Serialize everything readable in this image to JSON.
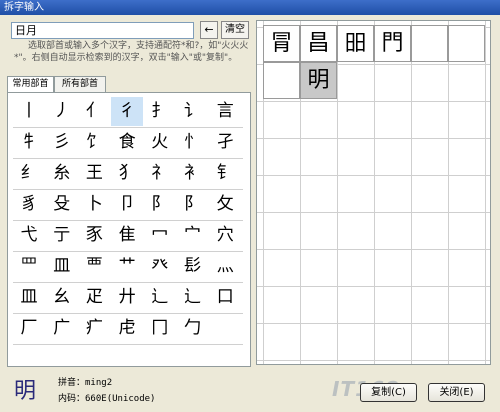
{
  "window": {
    "title": "拆字输入"
  },
  "search": {
    "value": "日月"
  },
  "buttons": {
    "back": "←",
    "clear": "清空",
    "copy": "复制(C)",
    "close": "关闭(E)"
  },
  "hint": "选取部首或输入多个汉字，支持通配符*和?，如\"火火火*\"。右侧自动显示检索到的汉字，双击\"输入\"或\"复制\"。",
  "tabs": [
    {
      "label": "常用部首"
    },
    {
      "label": "所有部首"
    }
  ],
  "radicals": [
    [
      "丨",
      "丿",
      "亻",
      "彳",
      "扌",
      "讠",
      "言"
    ],
    [
      "牜",
      "彡",
      "饣",
      "食",
      "火",
      "忄",
      "孑"
    ],
    [
      "纟",
      "糸",
      "王",
      "犭",
      "礻",
      "衤",
      "钅"
    ],
    [
      "豸",
      "殳",
      "卜",
      "卩",
      "阝",
      "阝",
      "攵"
    ],
    [
      "弋",
      "亍",
      "豕",
      "隹",
      "冖",
      "宀",
      "穴"
    ],
    [
      "罒",
      "皿",
      "覀",
      "艹",
      "癶",
      "髟",
      "灬"
    ],
    [
      "皿",
      "幺",
      "疋",
      "廾",
      "辶",
      "辶",
      "口"
    ],
    [
      "厂",
      "广",
      "疒",
      "虍",
      "冂",
      "勹"
    ]
  ],
  "selected_radical": "彳",
  "results": [
    [
      "冐",
      "昌",
      "昍",
      "門",
      "",
      ""
    ],
    [
      "",
      "明"
    ]
  ],
  "preview": {
    "char": "明",
    "pinyin_label": "拼音：",
    "pinyin": "ming2",
    "code_label": "内码：",
    "code": "660E(Unicode)"
  },
  "watermark": "IT168"
}
